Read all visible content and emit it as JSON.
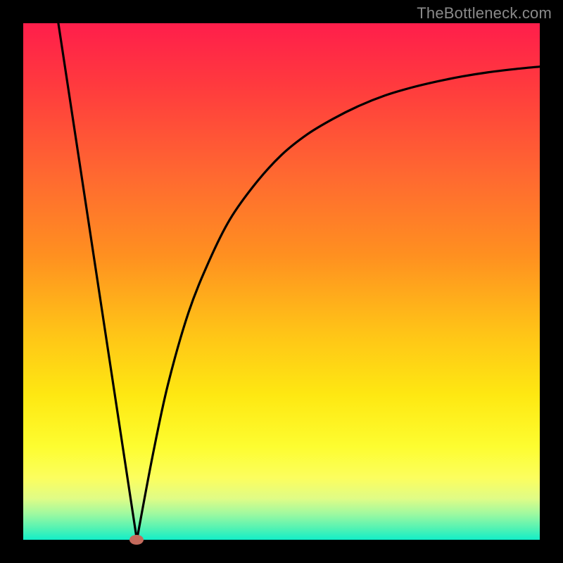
{
  "watermark": "TheBottleneck.com",
  "colors": {
    "frame": "#000000",
    "curve": "#000000",
    "dot": "#c46a5c",
    "gradient_top": "#ff1e4b",
    "gradient_bottom": "#12eec8"
  },
  "chart_data": {
    "type": "line",
    "title": "",
    "xlabel": "",
    "ylabel": "",
    "xlim": [
      0,
      100
    ],
    "ylim": [
      0,
      100
    ],
    "grid": false,
    "legend": false,
    "annotations": [
      {
        "type": "marker",
        "x": 22,
        "y": 0,
        "shape": "ellipse",
        "color": "#c46a5c"
      }
    ],
    "series": [
      {
        "name": "left-segment",
        "x": [
          6.8,
          22
        ],
        "y": [
          100,
          0
        ]
      },
      {
        "name": "right-curve",
        "x": [
          22,
          25,
          28,
          32,
          36,
          40,
          45,
          50,
          55,
          60,
          65,
          70,
          75,
          80,
          85,
          90,
          95,
          100
        ],
        "y": [
          0,
          16,
          30,
          44,
          54,
          62,
          69,
          74.5,
          78.5,
          81.5,
          84,
          86,
          87.5,
          88.7,
          89.7,
          90.5,
          91.1,
          91.6
        ]
      }
    ]
  }
}
